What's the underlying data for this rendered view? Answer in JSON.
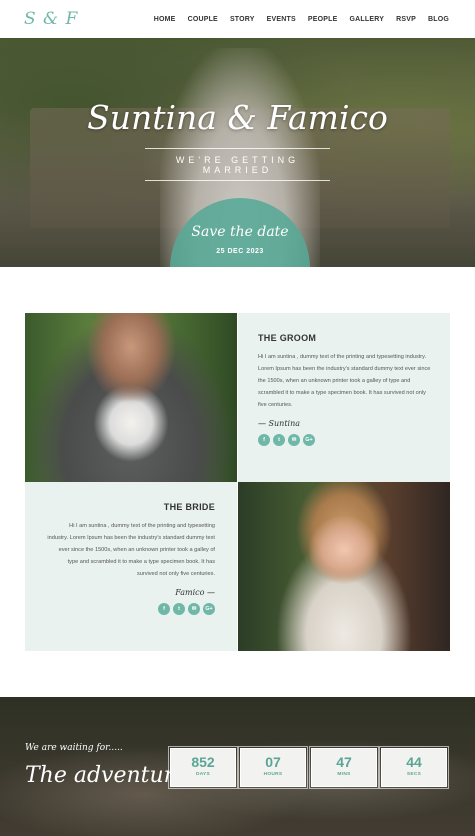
{
  "nav": {
    "logo": "S & F",
    "items": [
      "HOME",
      "COUPLE",
      "STORY",
      "EVENTS",
      "PEOPLE",
      "GALLERY",
      "RSVP",
      "BLOG"
    ]
  },
  "hero": {
    "title": "Suntina & Famico",
    "subtitle": "WE'RE GETTING MARRIED",
    "save_date_label": "Save the date",
    "date": "25 DEC 2023"
  },
  "groom": {
    "heading": "THE GROOM",
    "bio": "Hi I am suntina , dummy text of the printing and typesetting industry. Lorem Ipsum has been the industry's standard dummy text ever since the 1500s, when an unknown printer took a galley of type and scrambled it to make a type specimen book. It has survived not only five centuries.",
    "signature": "— Suntina",
    "social": [
      "f",
      "t",
      "✉",
      "G+"
    ]
  },
  "bride": {
    "heading": "THE BRIDE",
    "bio": "Hi I am suntina , dummy text of the printing and typesetting industry. Lorem Ipsum has been the industry's standard dummy text ever since the 1500s, when an unknown printer took a galley of type and scrambled it to make a type specimen book. It has survived not only five centuries.",
    "signature": "Famico —",
    "social": [
      "f",
      "t",
      "✉",
      "G+"
    ]
  },
  "countdown": {
    "tagline": "We are waiting for.....",
    "headline": "The adventure",
    "units": [
      {
        "value": "852",
        "label": "DAYS"
      },
      {
        "value": "07",
        "label": "HOURS"
      },
      {
        "value": "47",
        "label": "MINS"
      },
      {
        "value": "44",
        "label": "SECS"
      }
    ]
  },
  "colors": {
    "accent": "#6fb8a8",
    "panel": "#e9f2ef"
  }
}
